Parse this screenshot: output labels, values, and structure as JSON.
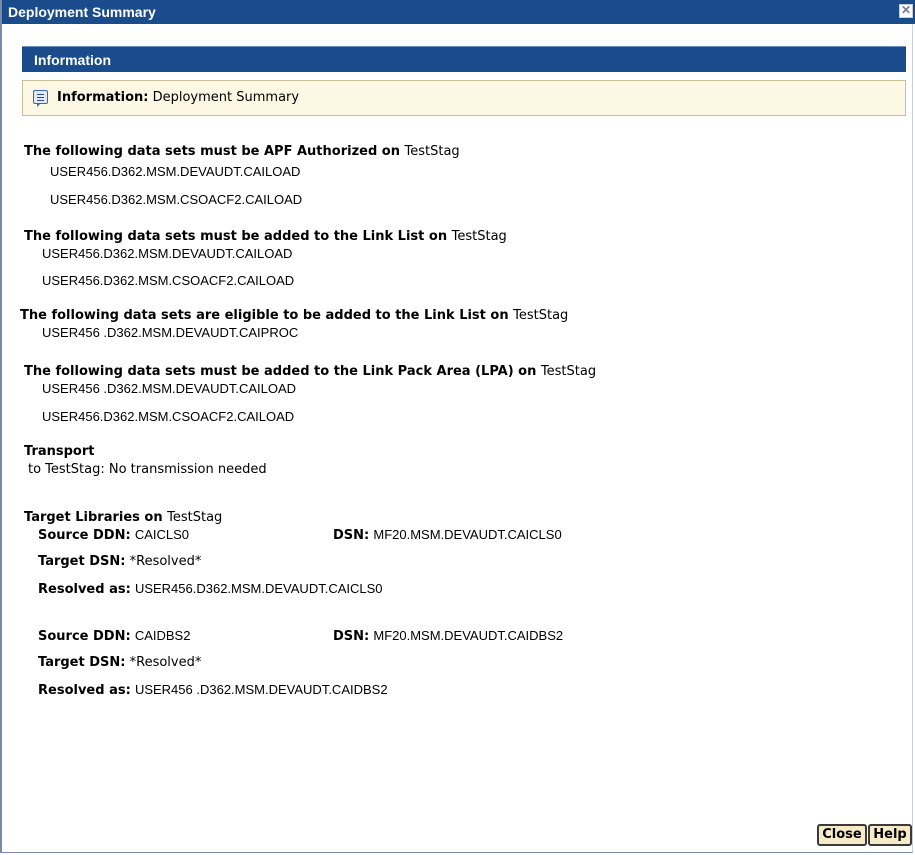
{
  "window": {
    "title": "Deployment Summary"
  },
  "section": {
    "title": "Information"
  },
  "info_banner": {
    "icon": "info-icon",
    "label": "Information:",
    "text": "Deployment Summary"
  },
  "apf": {
    "heading": "The following data sets must be APF Authorized on",
    "target": "TestStag",
    "datasets": [
      "USER456.D362.MSM.DEVAUDT.CAILOAD",
      "USER456.D362.MSM.CSOACF2.CAILOAD"
    ]
  },
  "linklist": {
    "heading": "The following data sets must be added to the Link List on",
    "target": "TestStag",
    "datasets": [
      "USER456.D362.MSM.DEVAUDT.CAILOAD",
      "USER456.D362.MSM.CSOACF2.CAILOAD"
    ]
  },
  "eligible": {
    "heading": "The following data sets are eligible to be added to the Link List on",
    "target": "TestStag",
    "datasets": [
      "USER456 .D362.MSM.DEVAUDT.CAIPROC"
    ]
  },
  "lpa": {
    "heading": "The following data sets must be added to the Link Pack Area (LPA) on",
    "target": "TestStag",
    "datasets": [
      "USER456 .D362.MSM.DEVAUDT.CAILOAD",
      "USER456.D362.MSM.CSOACF2.CAILOAD"
    ]
  },
  "transport": {
    "heading": "Transport",
    "text": "to TestStag: No transmission needed"
  },
  "target_libraries": {
    "heading": "Target Libraries on",
    "target": "TestStag",
    "entries": [
      {
        "source_ddn_label": "Source DDN:",
        "source_ddn": "CAICLS0",
        "dsn_label": "DSN:",
        "dsn": "MF20.MSM.DEVAUDT.CAICLS0",
        "target_dsn_label": "Target DSN:",
        "target_dsn": "*Resolved*",
        "resolved_label": "Resolved as:",
        "resolved": "USER456.D362.MSM.DEVAUDT.CAICLS0"
      },
      {
        "source_ddn_label": "Source DDN:",
        "source_ddn": "CAIDBS2",
        "dsn_label": "DSN:",
        "dsn": "MF20.MSM.DEVAUDT.CAIDBS2",
        "target_dsn_label": "Target DSN:",
        "target_dsn": "*Resolved*",
        "resolved_label": "Resolved as:",
        "resolved": "USER456 .D362.MSM.DEVAUDT.CAIDBS2"
      }
    ]
  },
  "buttons": {
    "close": "Close",
    "help": "Help"
  },
  "colors": {
    "titlebar": "#1a4c8c",
    "info_background": "#fcf8e3",
    "button_background": "#f6ebc6"
  }
}
